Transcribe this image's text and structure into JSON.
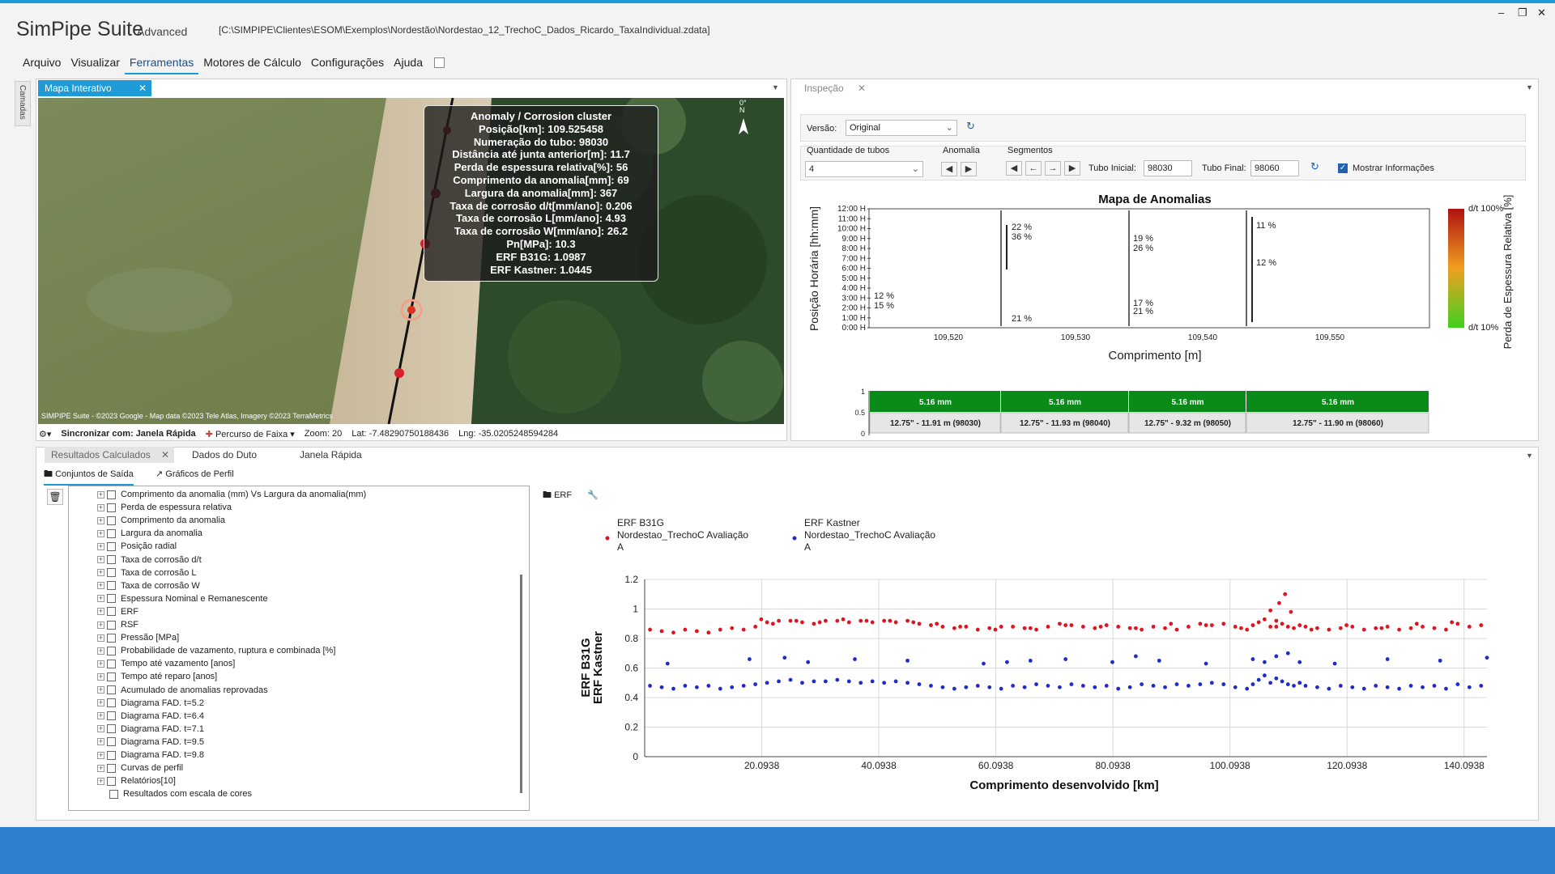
{
  "app": {
    "title": "SimPipe Suite",
    "edition": "Advanced",
    "file_path": "[C:\\SIMPIPE\\Clientes\\ESOM\\Exemplos\\Nordestão\\Nordestao_12_TrechoC_Dados_Ricardo_TaxaIndividual.zdata]"
  },
  "menu": [
    "Arquivo",
    "Visualizar",
    "Ferramentas",
    "Motores de Cálculo",
    "Configurações",
    "Ajuda"
  ],
  "sidebar_label": "Camadas",
  "map_panel": {
    "tab": "Mapa Interativo",
    "north_label": "0°\nN",
    "tooltip_lines": [
      "Anomaly / Corrosion cluster",
      "Posição[km]: 109.525458",
      "Numeração do tubo: 98030",
      "Distância até junta anterior[m]: 11.7",
      "Perda de espessura relativa[%]: 56",
      "Comprimento da anomalia[mm]: 69",
      "Largura da anomalia[mm]: 367",
      "Taxa de corrosão d/t[mm/ano]: 0.206",
      "Taxa de corrosão L[mm/ano]: 4.93",
      "Taxa de corrosão W[mm/ano]: 26.2",
      "Pn[MPa]: 10.3",
      "ERF B31G: 1.0987",
      "ERF Kastner: 1.0445"
    ],
    "attribution": "SIMPIPE Suite - ©2023 Google - Map data ©2023 Tele Atlas, Imagery ©2023 TerraMetrics",
    "status": {
      "sync": "Sincronizar com: Janela Rápida",
      "track": "Percurso de Faixa",
      "zoom": "Zoom: 20",
      "lat": "Lat: -7.48290750188436",
      "lng": "Lng: -35.0205248594284"
    }
  },
  "inspection_panel": {
    "tab": "Inspeção",
    "version_label": "Versão:",
    "version_value": "Original",
    "qty_label": "Quantidade de tubos",
    "qty_value": "4",
    "anomaly_label": "Anomalia",
    "segments_label": "Segmentos",
    "tube_start_label": "Tubo Inicial:",
    "tube_start_value": "98030",
    "tube_end_label": "Tubo Final:",
    "tube_end_value": "98060",
    "show_info_label": "Mostrar Informações"
  },
  "anomaly_map": {
    "title": "Mapa de Anomalias",
    "ylabel": "Posição Horária [hh:mm]",
    "xlabel": "Comprimento [m]",
    "yticks": [
      "12:00 H",
      "11:00 H",
      "10:00 H",
      "9:00 H",
      "8:00 H",
      "7:00 H",
      "6:00 H",
      "5:00 H",
      "4:00 H",
      "3:00 H",
      "2:00 H",
      "1:00 H",
      "0:00 H"
    ],
    "xticks": [
      "109,520",
      "109,530",
      "109,540",
      "109,550"
    ],
    "colorbar_top": "d/t 100%",
    "colorbar_bottom": "d/t 10%",
    "colorbar_label": "Perda de Espessura Relativa [%]",
    "percent_labels": [
      "22 %",
      "36 %",
      "12 %",
      "15 %",
      "21 %",
      "19 %",
      "26 %",
      "17 %",
      "21 %",
      "11 %",
      "12 %"
    ],
    "segments": [
      {
        "wall": "5.16 mm",
        "desc": "12.75\" - 11.91 m (98030)"
      },
      {
        "wall": "5.16 mm",
        "desc": "12.75\" - 11.93 m (98040)"
      },
      {
        "wall": "5.16 mm",
        "desc": "12.75\" - 9.32 m (98050)"
      },
      {
        "wall": "5.16 mm",
        "desc": "12.75\" - 11.90 m (98060)"
      }
    ],
    "segment_yticks": [
      "1",
      "0.5",
      "0"
    ]
  },
  "bottom_tabs": [
    "Resultados Calculados",
    "Dados do Duto",
    "Janela Rápida"
  ],
  "subtabs": [
    "Conjuntos de Saída",
    "Gráficos de Perfil"
  ],
  "tree_items": [
    "Comprimento da anomalia (mm) Vs Largura da anomalia(mm)",
    "Perda de espessura relativa",
    "Comprimento da anomalia",
    "Largura da anomalia",
    "Posição radial",
    "Taxa de corrosão d/t",
    "Taxa de corrosão L",
    "Taxa de corrosão W",
    "Espessura Nominal e Remanescente",
    "ERF",
    "RSF",
    "Pressão [MPa]",
    "Probabilidade de vazamento, ruptura e combinada [%]",
    "Tempo até vazamento [anos]",
    "Tempo até reparo [anos]",
    "Acumulado de anomalias reprovadas",
    "Diagrama FAD. t=5.2",
    "Diagrama FAD. t=6.4",
    "Diagrama FAD. t=7.1",
    "Diagrama FAD. t=9.5",
    "Diagrama FAD. t=9.8",
    "Curvas de perfil",
    "Relatórios[10]",
    "Resultados com escala de cores"
  ],
  "erf_toolbar_label": "ERF",
  "chart_data": {
    "type": "scatter",
    "xlabel": "Comprimento desenvolvido [km]",
    "ylabel": "ERF B31G\nERF Kastner",
    "xlim": [
      0.09,
      144
    ],
    "ylim": [
      0,
      1.2
    ],
    "xticks": [
      20.0938,
      40.0938,
      60.0938,
      80.0938,
      100.0938,
      120.0938,
      140.0938
    ],
    "xtick_labels": [
      "20.0938",
      "40.0938",
      "60.0938",
      "80.0938",
      "100.0938",
      "120.0938",
      "140.0938"
    ],
    "yticks": [
      0,
      0.2,
      0.4,
      0.6,
      0.8,
      1,
      1.2
    ],
    "ytick_labels": [
      "0",
      "0.2",
      "0.4",
      "0.6",
      "0.8",
      "1",
      "1.2"
    ],
    "grid": true,
    "legend": "top-left",
    "series": [
      {
        "name": "ERF B31G\nNordestao_TrechoC Avaliação\nA",
        "color": "#e0141e",
        "x": [
          1,
          3,
          5,
          7,
          9,
          11,
          13,
          15,
          17,
          19,
          21,
          23,
          25,
          27,
          29,
          31,
          33,
          35,
          37,
          39,
          41,
          43,
          45,
          47,
          49,
          51,
          53,
          55,
          57,
          59,
          61,
          63,
          65,
          67,
          69,
          71,
          73,
          75,
          77,
          79,
          81,
          83,
          85,
          87,
          89,
          91,
          93,
          95,
          97,
          99,
          101,
          103,
          104,
          105,
          106,
          107,
          108,
          109,
          110,
          111,
          112,
          113,
          115,
          117,
          119,
          121,
          123,
          125,
          127,
          129,
          131,
          133,
          135,
          137,
          139,
          141,
          143,
          20,
          22,
          26,
          30,
          34,
          38,
          42,
          46,
          50,
          54,
          60,
          66,
          72,
          78,
          84,
          90,
          96,
          102,
          108,
          114,
          120,
          126,
          132,
          138,
          107,
          108.5,
          109.5,
          110.5
        ],
        "y": [
          0.86,
          0.85,
          0.84,
          0.86,
          0.85,
          0.84,
          0.86,
          0.87,
          0.86,
          0.88,
          0.91,
          0.92,
          0.92,
          0.91,
          0.9,
          0.92,
          0.92,
          0.91,
          0.92,
          0.91,
          0.92,
          0.91,
          0.92,
          0.9,
          0.89,
          0.88,
          0.87,
          0.88,
          0.86,
          0.87,
          0.88,
          0.88,
          0.87,
          0.86,
          0.88,
          0.9,
          0.89,
          0.88,
          0.87,
          0.89,
          0.88,
          0.87,
          0.86,
          0.88,
          0.87,
          0.86,
          0.88,
          0.9,
          0.89,
          0.9,
          0.88,
          0.86,
          0.89,
          0.91,
          0.93,
          0.88,
          0.92,
          0.9,
          0.88,
          0.87,
          0.89,
          0.88,
          0.87,
          0.86,
          0.87,
          0.88,
          0.86,
          0.87,
          0.88,
          0.86,
          0.87,
          0.88,
          0.87,
          0.86,
          0.9,
          0.88,
          0.89,
          0.93,
          0.9,
          0.92,
          0.91,
          0.93,
          0.92,
          0.92,
          0.91,
          0.9,
          0.88,
          0.86,
          0.87,
          0.89,
          0.88,
          0.87,
          0.9,
          0.89,
          0.87,
          0.88,
          0.86,
          0.89,
          0.87,
          0.9,
          0.91,
          0.99,
          1.04,
          1.1,
          0.98
        ]
      },
      {
        "name": "ERF Kastner\nNordestao_TrechoC Avaliação\nA",
        "color": "#1f2ccc",
        "x": [
          1,
          3,
          5,
          7,
          9,
          11,
          13,
          15,
          17,
          19,
          21,
          23,
          25,
          27,
          29,
          31,
          33,
          35,
          37,
          39,
          41,
          43,
          45,
          47,
          49,
          51,
          53,
          55,
          57,
          59,
          61,
          63,
          65,
          67,
          69,
          71,
          73,
          75,
          77,
          79,
          81,
          83,
          85,
          87,
          89,
          91,
          93,
          95,
          97,
          99,
          101,
          103,
          104,
          105,
          106,
          107,
          108,
          109,
          110,
          111,
          112,
          113,
          115,
          117,
          119,
          121,
          123,
          125,
          127,
          129,
          131,
          133,
          135,
          137,
          139,
          141,
          143,
          4,
          18,
          24,
          28,
          36,
          45,
          58,
          62,
          66,
          72,
          80,
          84,
          88,
          96,
          104,
          106,
          108,
          110,
          112,
          118,
          127,
          136,
          144
        ],
        "y": [
          0.48,
          0.47,
          0.46,
          0.48,
          0.47,
          0.48,
          0.46,
          0.47,
          0.48,
          0.49,
          0.5,
          0.51,
          0.52,
          0.5,
          0.51,
          0.51,
          0.52,
          0.51,
          0.5,
          0.51,
          0.5,
          0.51,
          0.5,
          0.49,
          0.48,
          0.47,
          0.46,
          0.47,
          0.48,
          0.47,
          0.46,
          0.48,
          0.47,
          0.49,
          0.48,
          0.47,
          0.49,
          0.48,
          0.47,
          0.48,
          0.46,
          0.47,
          0.49,
          0.48,
          0.47,
          0.49,
          0.48,
          0.49,
          0.5,
          0.49,
          0.47,
          0.46,
          0.49,
          0.52,
          0.55,
          0.5,
          0.53,
          0.51,
          0.49,
          0.48,
          0.5,
          0.48,
          0.47,
          0.46,
          0.48,
          0.47,
          0.46,
          0.48,
          0.47,
          0.46,
          0.48,
          0.47,
          0.48,
          0.46,
          0.49,
          0.47,
          0.48,
          0.63,
          0.66,
          0.67,
          0.64,
          0.66,
          0.65,
          0.63,
          0.64,
          0.65,
          0.66,
          0.64,
          0.68,
          0.65,
          0.63,
          0.66,
          0.64,
          0.68,
          0.7,
          0.64,
          0.63,
          0.66,
          0.65,
          0.67
        ]
      }
    ]
  }
}
